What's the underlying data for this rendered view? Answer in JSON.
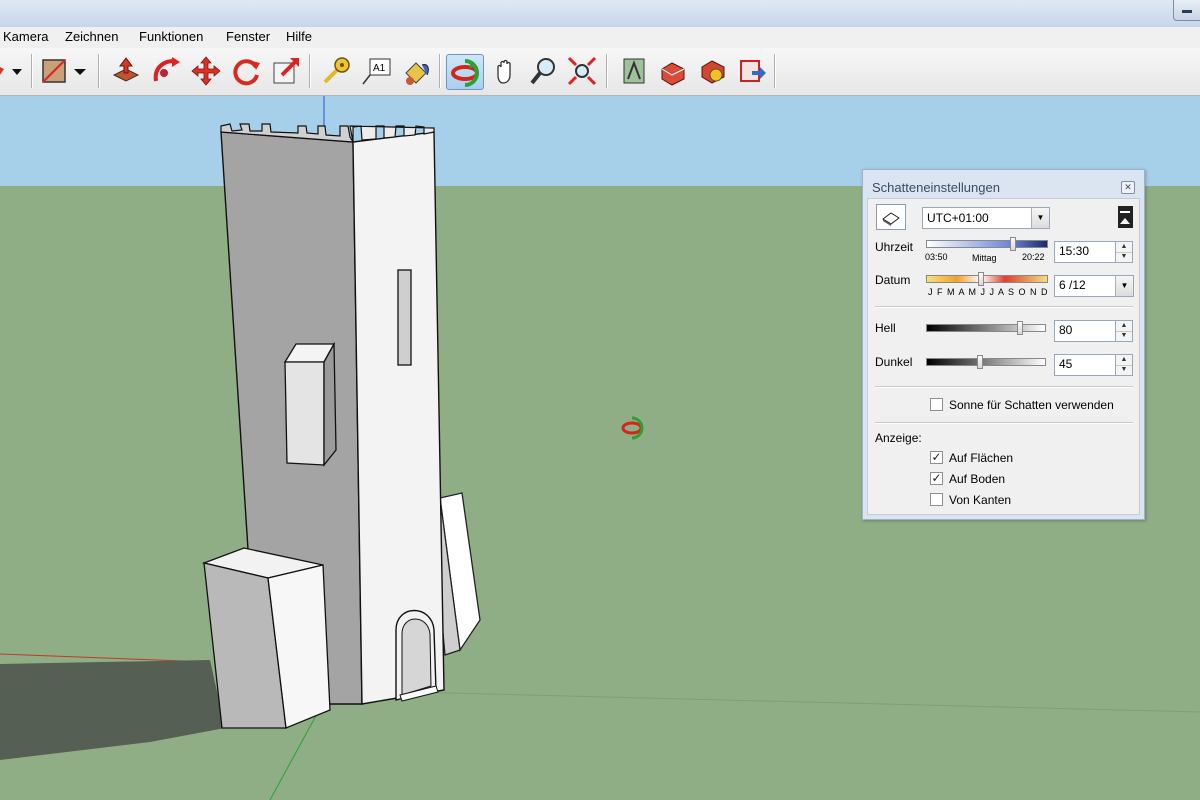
{
  "menu": [
    "Kamera",
    "Zeichnen",
    "Funktionen",
    "Fenster",
    "Hilfe"
  ],
  "toolbar": {
    "icons": [
      "dropdown-icon",
      "section-plane-icon",
      "dropdown-icon",
      "push-pull-icon",
      "follow-me-icon",
      "move-icon",
      "rotate-icon",
      "scale-icon",
      "tape-measure-icon",
      "text-icon",
      "paint-bucket-icon",
      "orbit-icon",
      "pan-icon",
      "zoom-icon",
      "zoom-extents-icon",
      "previous-view-icon",
      "get-models-icon",
      "share-model-icon",
      "send-to-layout-icon"
    ],
    "active": "orbit-icon"
  },
  "shadow_dialog": {
    "title": "Schatteneinstellungen",
    "timezone": "UTC+01:00",
    "time": {
      "label": "Uhrzeit",
      "start": "03:50",
      "middle": "Mittag",
      "end": "20:22",
      "value": "15:30",
      "slider_fraction": 0.72
    },
    "date": {
      "label": "Datum",
      "months": "J F M A M J J A S O N D",
      "value": "6 /12",
      "slider_fraction": 0.45
    },
    "light": {
      "label": "Hell",
      "value": "80",
      "slider_fraction": 0.8
    },
    "dark": {
      "label": "Dunkel",
      "value": "45",
      "slider_fraction": 0.45
    },
    "use_sun": {
      "label": "Sonne für Schatten verwenden",
      "checked": false
    },
    "display": {
      "label": "Anzeige:",
      "on_faces": {
        "label": "Auf Flächen",
        "checked": true
      },
      "on_ground": {
        "label": "Auf Boden",
        "checked": true
      },
      "from_edges": {
        "label": "Von Kanten",
        "checked": false
      }
    }
  },
  "colors": {
    "sky": "#a6cfe9",
    "ground": "#8fae85",
    "accent": "#3a6fb5"
  }
}
